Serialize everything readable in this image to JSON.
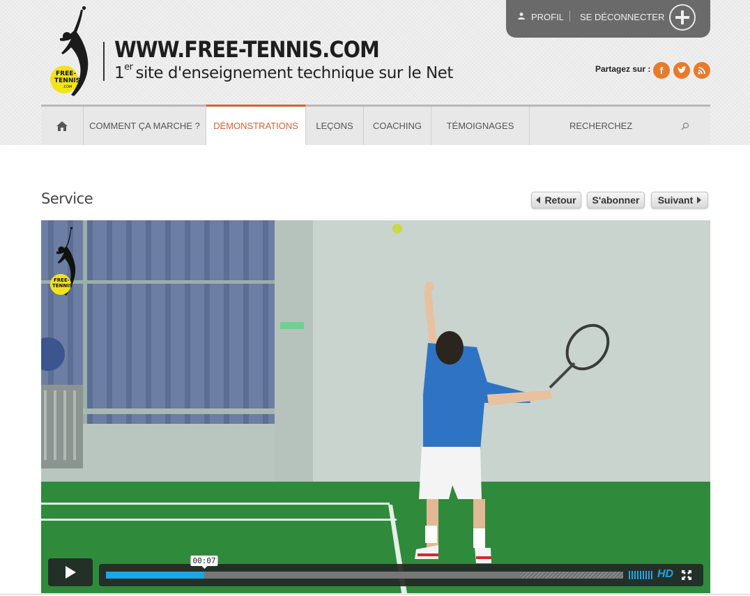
{
  "header": {
    "logo_text_line1": "FREE-",
    "logo_text_line2": "TENNIS",
    "logo_text_line3": ".COM",
    "site_title": "WWW.FREE-TENNIS.COM",
    "tagline_prefix": "1",
    "tagline_sup": "er",
    "tagline_rest": "site d'enseignement technique sur le Net"
  },
  "user_panel": {
    "profile_label": "PROFIL",
    "logout_label": "SE DÉCONNECTER",
    "plus_icon": "plus-circle-icon"
  },
  "share": {
    "label": "Partagez sur :",
    "icons": [
      {
        "name": "facebook-icon",
        "glyph": "f"
      },
      {
        "name": "twitter-icon",
        "glyph": "t"
      },
      {
        "name": "rss-icon",
        "glyph": "◉"
      }
    ],
    "color": "#e87a2c"
  },
  "nav": {
    "home_icon": "home-icon",
    "items": [
      {
        "label": "COMMENT ÇA MARCHE ?",
        "active": false
      },
      {
        "label": "DÉMONSTRATIONS",
        "active": true
      },
      {
        "label": "LEÇONS",
        "active": false
      },
      {
        "label": "COACHING",
        "active": false
      },
      {
        "label": "TÉMOIGNAGES",
        "active": false
      }
    ],
    "search_placeholder": "RECHERCHEZ",
    "active_color": "#d9612b"
  },
  "content": {
    "page_title": "Service",
    "back_label": "Retour",
    "subscribe_label": "S'abonner",
    "next_label": "Suivant"
  },
  "video": {
    "current_time": "00:07",
    "played_fraction": 0.19,
    "loaded_fraction": 0.8,
    "hd_label": "HD",
    "accent_color": "#1aa7e8",
    "overlay_logo_line1": "FREE-",
    "overlay_logo_line2": "TENNIS"
  }
}
